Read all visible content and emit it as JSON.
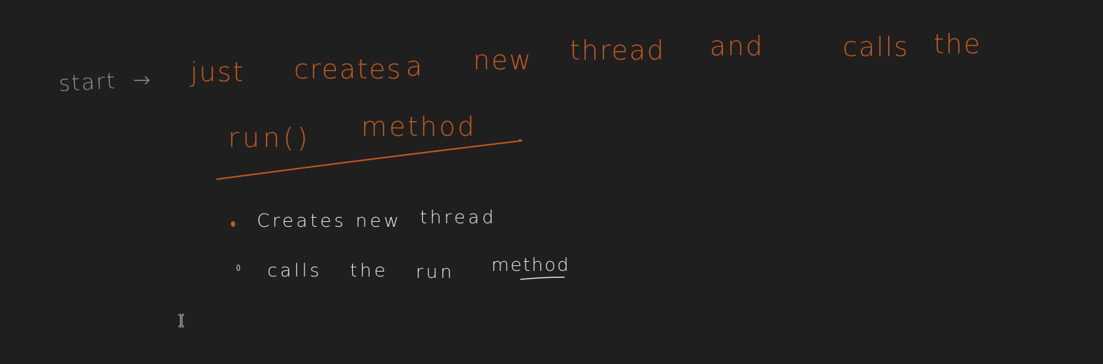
{
  "colors": {
    "background": "#1f1f1f",
    "orange_ink": "#c65a1e",
    "gray_ink": "#8a9199",
    "white_ink": "#e8e8e8"
  },
  "line1": {
    "label": "start",
    "arrow": "→",
    "words": [
      "just",
      "creates",
      "a",
      "new",
      "thread",
      "and",
      "calls",
      "the"
    ]
  },
  "line2": {
    "words": [
      "run()",
      "method"
    ]
  },
  "bullets": [
    {
      "words": [
        "Creates",
        "new",
        "thread"
      ]
    },
    {
      "words": [
        "calls",
        "the",
        "run",
        "method"
      ]
    }
  ],
  "cursor_icon": "text-cursor-icon"
}
